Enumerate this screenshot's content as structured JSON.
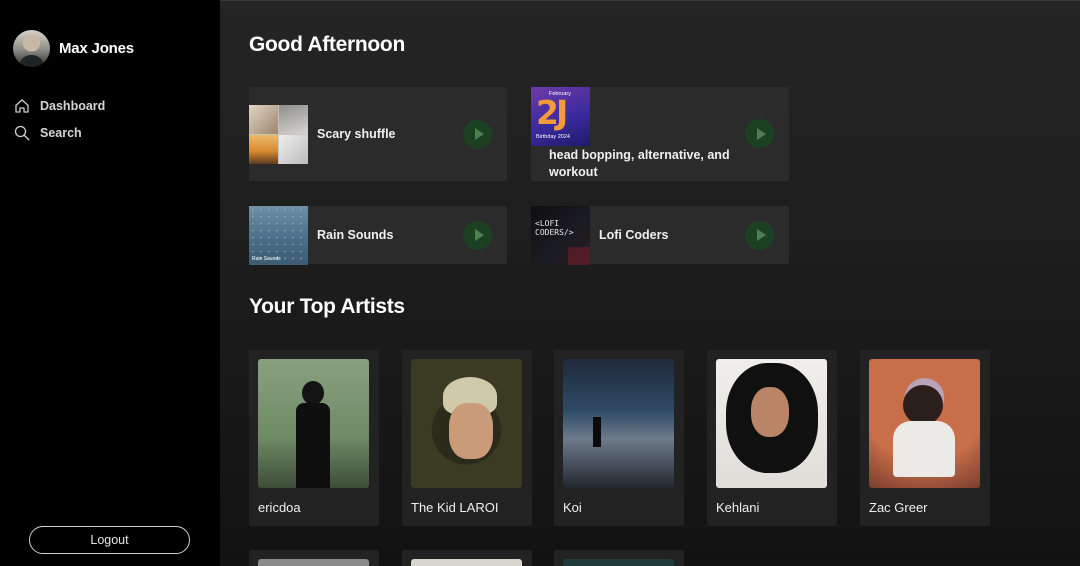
{
  "profile": {
    "name": "Max Jones"
  },
  "nav": {
    "items": [
      {
        "label": "Dashboard",
        "icon": "home-icon"
      },
      {
        "label": "Search",
        "icon": "search-icon"
      }
    ]
  },
  "logout_label": "Logout",
  "greeting": "Good Afternoon",
  "playlists": [
    {
      "name": "Scary shuffle"
    },
    {
      "name": "head bopping, alternative, and workout",
      "cover_text": "2J",
      "cover_caption": "Birthday 2024",
      "cover_month": "February"
    },
    {
      "name": "Rain Sounds",
      "cover_caption": "Rain Sounds"
    },
    {
      "name": "Lofi Coders",
      "cover_text": "<LOFI\nCODERS/>"
    }
  ],
  "top_artists_title": "Your Top Artists",
  "artists": [
    {
      "name": "ericdoa"
    },
    {
      "name": "The Kid LAROI"
    },
    {
      "name": "Koi"
    },
    {
      "name": "Kehlani"
    },
    {
      "name": "Zac Greer"
    }
  ],
  "colors": {
    "accent": "#1c4122",
    "sidebar": "#000000",
    "card": "#2b2b2b"
  }
}
